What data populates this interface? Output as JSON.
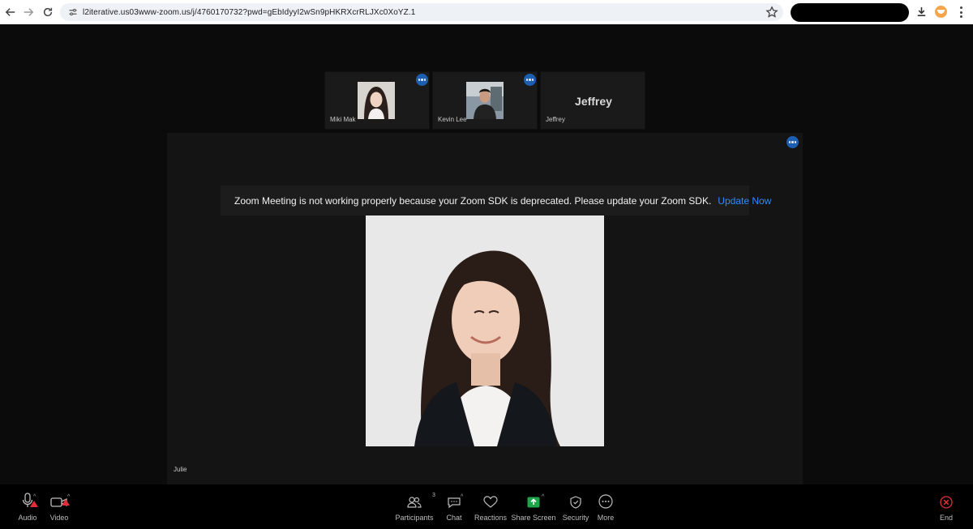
{
  "browser": {
    "url": "l2iterative.us03www-zoom.us/j/4760170732?pwd=gEbIdyyI2wSn9pHKRXcrRLJXc0XoYZ.1"
  },
  "participants_strip": [
    {
      "name": "Miki Mak",
      "has_video": true
    },
    {
      "name": "Kevin Lee",
      "has_video": true
    },
    {
      "name": "Jeffrey",
      "display_initial_name": "Jeffrey",
      "has_video": false
    }
  ],
  "speaker": {
    "name": "Julie"
  },
  "warning": {
    "message": "Zoom Meeting is not working properly because your Zoom SDK is deprecated. Please update your Zoom SDK.",
    "action_label": "Update Now",
    "icon": "warning-triangle-icon",
    "icon_color": "#f7a234",
    "link_color": "#2d8cff"
  },
  "toolbar": {
    "audio_label": "Audio",
    "video_label": "Video",
    "participants_label": "Participants",
    "participants_count": "3",
    "chat_label": "Chat",
    "reactions_label": "Reactions",
    "share_label": "Share Screen",
    "security_label": "Security",
    "more_label": "More",
    "end_label": "End",
    "share_color": "#1fa449",
    "end_color": "#e02f3a"
  }
}
